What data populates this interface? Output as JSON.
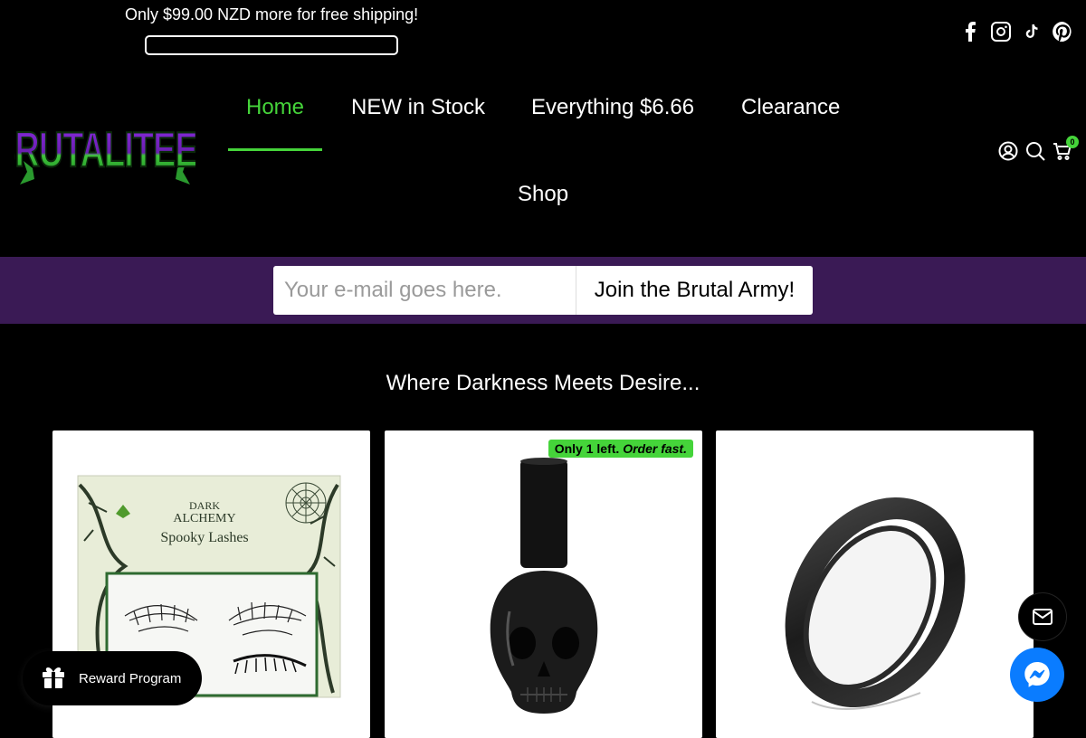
{
  "announcement": {
    "shipping_text": "Only $99.00 NZD more for free shipping!",
    "shipping_progress_fraction": 0.0
  },
  "social": {
    "icons": [
      "facebook-icon",
      "instagram-icon",
      "tiktok-icon",
      "pinterest-icon"
    ]
  },
  "brand": {
    "logo_text": "BRUTALITEES",
    "colors": {
      "accent_green": "#45d43a",
      "logo_purple": "#8a2be2",
      "band_purple": "#3a1a55"
    }
  },
  "nav": {
    "items": [
      {
        "label": "Home",
        "active": true
      },
      {
        "label": "NEW in Stock",
        "active": false
      },
      {
        "label": "Everything $6.66",
        "active": false
      },
      {
        "label": "Clearance",
        "active": false
      },
      {
        "label": "Shop",
        "active": false
      }
    ]
  },
  "header_icons": {
    "account": "user-icon",
    "search": "search-icon",
    "cart": "cart-icon",
    "cart_count": "0"
  },
  "newsletter": {
    "placeholder": "Your e-mail goes here.",
    "button_label": "Join the Brutal Army!"
  },
  "section": {
    "title": "Where Darkness Meets Desire..."
  },
  "products": [
    {
      "image": "spooky-lashes-box",
      "badge": ""
    },
    {
      "image": "skull-nail-polish",
      "badge_prefix": "Only 1 left.",
      "badge_emphasis": "Order fast."
    },
    {
      "image": "black-ring",
      "badge": ""
    }
  ],
  "product_image_text": {
    "brand_line1": "DARK",
    "brand_line2": "ALCHEMY",
    "product_name": "Spooky Lashes"
  },
  "widgets": {
    "reward_label": "Reward Program",
    "mail_icon": "mail-icon",
    "messenger_icon": "messenger-icon"
  }
}
